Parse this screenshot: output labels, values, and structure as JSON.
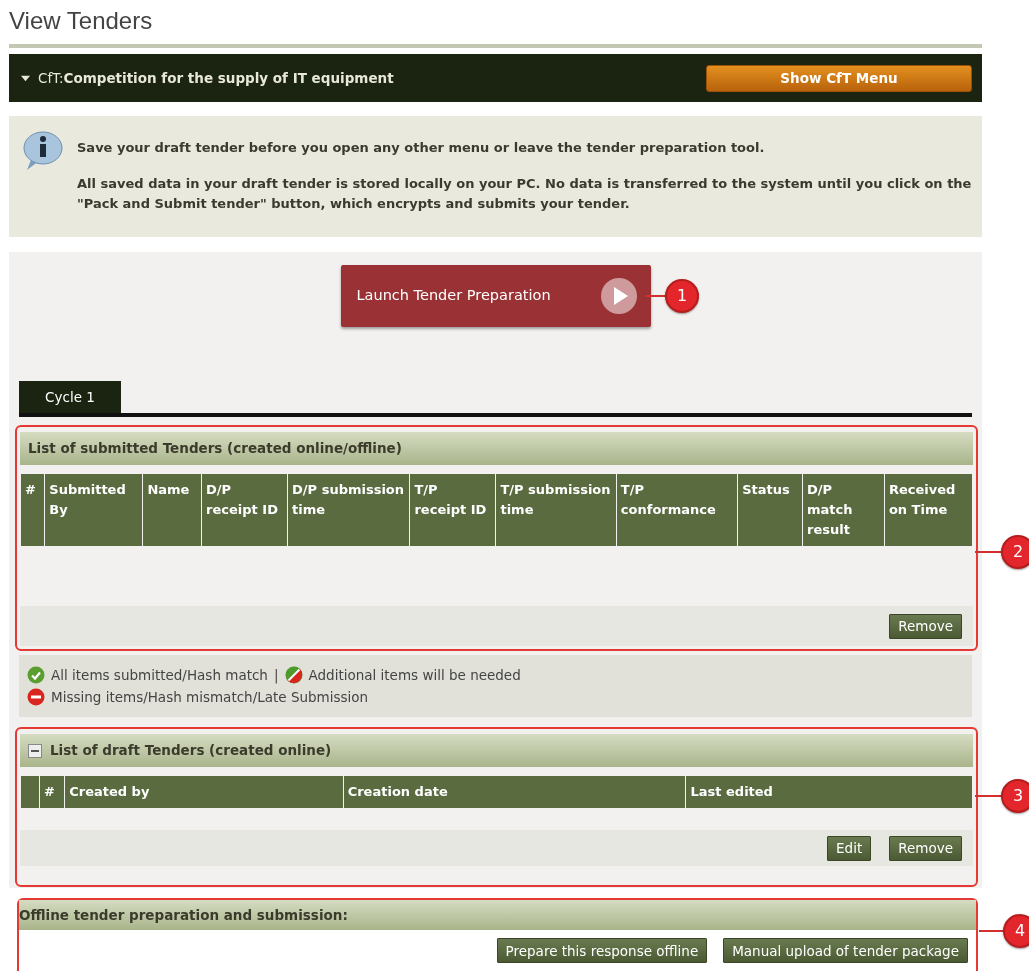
{
  "page_title": "View Tenders",
  "cft_bar": {
    "expanded": true,
    "title": "CfT:**Competition for the supply of IT equipment**",
    "button": "Show CfT Menu"
  },
  "info": {
    "paragraphs": [
      "Save your draft tender before you open any other menu or leave the tender preparation tool.",
      "All saved data in your draft tender is stored locally on your PC. No data is transferred to the system until you click on the \"Pack and Submit tender\" button, which encrypts and submits your tender."
    ]
  },
  "launch": {
    "label": "Launch Tender Preparation",
    "callout": "1"
  },
  "tabs": [
    {
      "label": "Cycle 1",
      "selected": true
    }
  ],
  "submitted": {
    "title": "List of submitted Tenders (created online/offline)",
    "callout": "2",
    "columns": [
      "#",
      "Submitted By",
      "Name",
      "D/P receipt ID",
      "D/P submission time",
      "T/P receipt ID",
      "T/P submission time",
      "T/P conformance",
      "Status",
      "D/P match result",
      "Received on Time"
    ],
    "buttons": [
      "Remove"
    ]
  },
  "legend": {
    "lines": [
      [
        {
          "kind": "ok",
          "text": "All items submitted/Hash match"
        },
        {
          "kind": "separator",
          "text": "|"
        },
        {
          "kind": "partial",
          "text": "Additional items will be needed"
        }
      ],
      [
        {
          "kind": "error",
          "text": "Missing items/Hash mismatch/Late Submission"
        }
      ]
    ]
  },
  "drafts": {
    "title": "List of draft Tenders (created online)",
    "expanded": true,
    "callout": "3",
    "columns": [
      "#",
      "Created by",
      "Creation date",
      "Last edited"
    ],
    "buttons": [
      "Edit",
      "Remove"
    ]
  },
  "offline": {
    "title": "Offline tender preparation and submission:",
    "callout": "4",
    "buttons": [
      "Prepare this response offline",
      "Manual upload of tender package"
    ]
  }
}
